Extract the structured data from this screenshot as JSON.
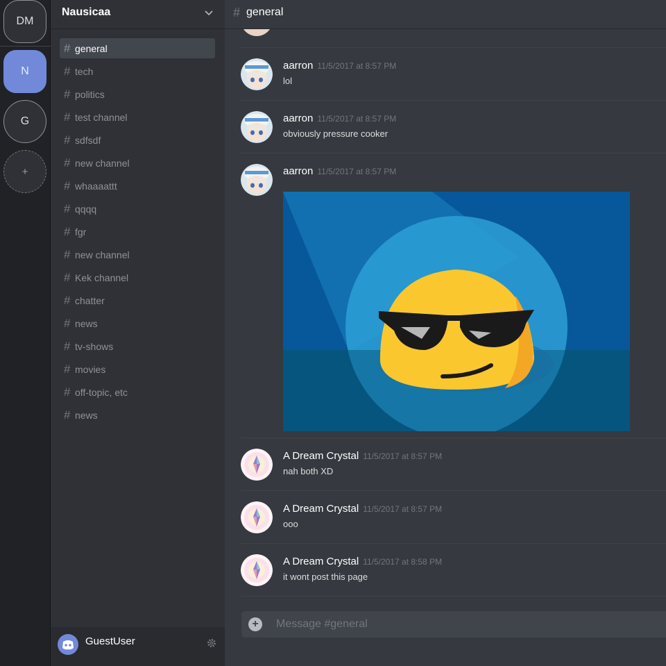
{
  "rail": {
    "servers": [
      {
        "label": "DM"
      },
      {
        "label": "N"
      },
      {
        "label": "G"
      }
    ],
    "add_label": "+"
  },
  "guild": {
    "name": "Nausicaa",
    "channels": [
      {
        "name": "general"
      },
      {
        "name": "tech"
      },
      {
        "name": "politics"
      },
      {
        "name": "test channel"
      },
      {
        "name": "sdfsdf"
      },
      {
        "name": "new channel"
      },
      {
        "name": "whaaaattt"
      },
      {
        "name": "qqqq"
      },
      {
        "name": "fgr"
      },
      {
        "name": "new channel"
      },
      {
        "name": "Kek channel"
      },
      {
        "name": "chatter"
      },
      {
        "name": "news"
      },
      {
        "name": "tv-shows"
      },
      {
        "name": "movies"
      },
      {
        "name": "off-topic, etc"
      },
      {
        "name": "news"
      }
    ],
    "hash": "#"
  },
  "user": {
    "name": "GuestUser"
  },
  "chat": {
    "hash": "#",
    "title": "general",
    "messages": [
      {
        "author": "aarron",
        "timestamp": "11/5/2017 at 8:57 PM",
        "text": "lol"
      },
      {
        "author": "aarron",
        "timestamp": "11/5/2017 at 8:57 PM",
        "text": "obviously pressure cooker"
      },
      {
        "author": "aarron",
        "timestamp": "11/5/2017 at 8:57 PM",
        "text": ""
      },
      {
        "author": "A Dream Crystal",
        "timestamp": "11/5/2017 at 8:57 PM",
        "text": "nah both XD"
      },
      {
        "author": "A Dream Crystal",
        "timestamp": "11/5/2017 at 8:57 PM",
        "text": "ooo"
      },
      {
        "author": "A Dream Crystal",
        "timestamp": "11/5/2017 at 8:58 PM",
        "text": "it wont post this page"
      }
    ],
    "placeholder": "Message #general"
  },
  "colors": {
    "accent": "#7289da",
    "background": "#36393f",
    "sidebar": "#2f3136",
    "rail": "#202225"
  }
}
